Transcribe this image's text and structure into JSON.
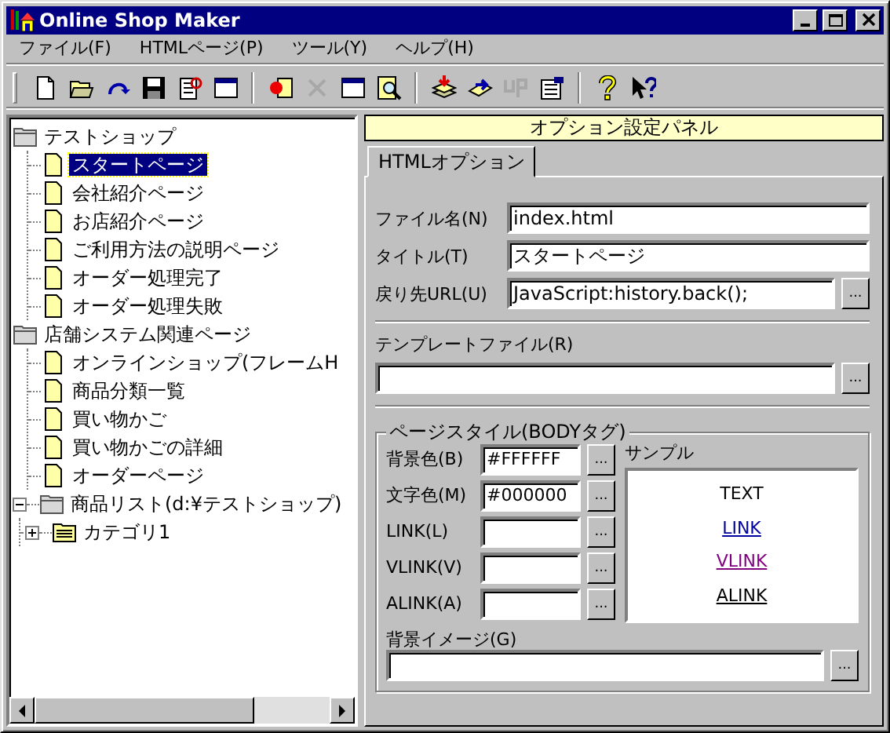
{
  "window": {
    "title": "Online Shop Maker"
  },
  "menu": [
    {
      "label": "ファイル(F)"
    },
    {
      "label": "HTMLページ(P)"
    },
    {
      "label": "ツール(Y)"
    },
    {
      "label": "ヘルプ(H)"
    }
  ],
  "toolbar_groups": [
    {
      "tools": [
        {
          "kind": "new",
          "disabled": false
        },
        {
          "kind": "open",
          "disabled": false
        },
        {
          "kind": "redo",
          "disabled": false
        },
        {
          "kind": "save",
          "disabled": false
        },
        {
          "kind": "edit",
          "disabled": false
        },
        {
          "kind": "window",
          "disabled": false
        }
      ]
    },
    {
      "tools": [
        {
          "kind": "insert",
          "disabled": false
        },
        {
          "kind": "delete",
          "disabled": true
        },
        {
          "kind": "window",
          "disabled": false
        },
        {
          "kind": "preview",
          "disabled": false
        }
      ]
    },
    {
      "tools": [
        {
          "kind": "download",
          "disabled": false
        },
        {
          "kind": "transfer",
          "disabled": false
        },
        {
          "kind": "upload",
          "disabled": true
        },
        {
          "kind": "properties",
          "disabled": false
        }
      ]
    },
    {
      "tools": [
        {
          "kind": "help",
          "disabled": false
        },
        {
          "kind": "context-help",
          "disabled": false
        }
      ]
    }
  ],
  "tree": [
    {
      "kind": "folder",
      "label": "テストショップ",
      "selected": false,
      "children": [
        {
          "kind": "page",
          "label": "スタートページ",
          "selected": true
        },
        {
          "kind": "page",
          "label": "会社紹介ページ",
          "selected": false
        },
        {
          "kind": "page",
          "label": "お店紹介ページ",
          "selected": false
        },
        {
          "kind": "page",
          "label": "ご利用方法の説明ページ",
          "selected": false
        },
        {
          "kind": "page",
          "label": "オーダー処理完了",
          "selected": false
        },
        {
          "kind": "page",
          "label": "オーダー処理失敗",
          "selected": false
        }
      ]
    },
    {
      "kind": "folder",
      "label": "店舗システム関連ページ",
      "selected": false,
      "children": [
        {
          "kind": "page",
          "label": "オンラインショップ(フレームH",
          "selected": false
        },
        {
          "kind": "page",
          "label": "商品分類一覧",
          "selected": false
        },
        {
          "kind": "page",
          "label": "買い物かご",
          "selected": false
        },
        {
          "kind": "page",
          "label": "買い物かごの詳細",
          "selected": false
        },
        {
          "kind": "page",
          "label": "オーダーページ",
          "selected": false
        }
      ]
    },
    {
      "kind": "folder",
      "label": "商品リスト(d:¥テストショップ)",
      "selected": false,
      "expanded": true,
      "children": [
        {
          "kind": "category",
          "label": "カテゴリ1",
          "selected": false,
          "expanded": false
        }
      ]
    }
  ],
  "panel": {
    "header": "オプション設定パネル",
    "tabs": [
      {
        "label": "HTMLオプション",
        "selected": true
      }
    ],
    "fields": [
      {
        "label": "ファイル名(N)",
        "value": "index.html"
      },
      {
        "label": "タイトル(T)",
        "value": "スタートページ"
      },
      {
        "label": "戻り先URL(U)",
        "value": "JavaScript:history.back();",
        "button": "..."
      }
    ],
    "template": {
      "label": "テンプレートファイル(R)",
      "button": "..."
    },
    "page_style": {
      "legend": "ページスタイル(BODYタグ)",
      "colors": [
        {
          "label": "背景色(B)",
          "value": "#FFFFFF",
          "button": "..."
        },
        {
          "label": "文字色(M)",
          "value": "#000000",
          "button": "..."
        },
        {
          "label": "LINK(L)",
          "button": "..."
        },
        {
          "label": "VLINK(V)",
          "button": "..."
        },
        {
          "label": "ALINK(A)",
          "button": "..."
        }
      ],
      "sample": {
        "label": "サンプル",
        "items": [
          {
            "kind": "text",
            "label": "TEXT",
            "color": "#000000"
          },
          {
            "kind": "link",
            "label": "LINK",
            "color": "#0000a0"
          },
          {
            "kind": "link",
            "label": "VLINK",
            "color": "#800080"
          },
          {
            "kind": "link",
            "label": "ALINK",
            "color": "#000000"
          }
        ]
      },
      "background_image": {
        "label": "背景イメージ(G)",
        "button": "..."
      }
    }
  }
}
